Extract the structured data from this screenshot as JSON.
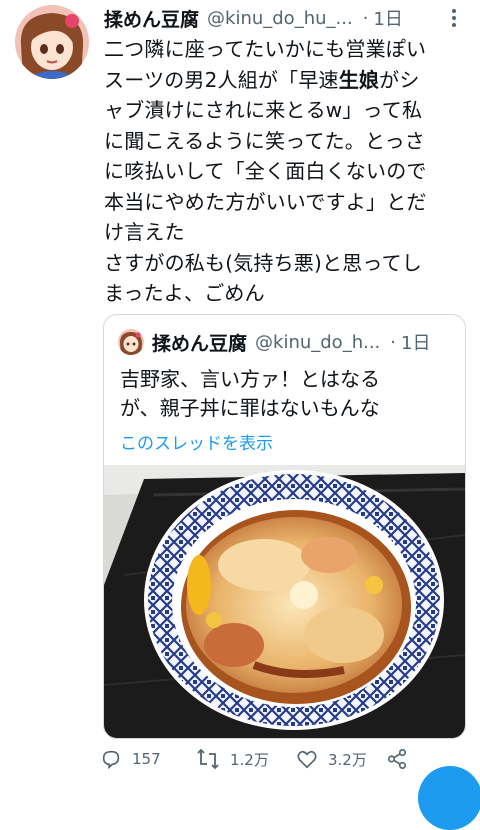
{
  "tweet": {
    "author_name": "揉めん豆腐",
    "handle": "@kinu_do_hu_...",
    "separator": "·",
    "time": "1日",
    "text_lines": [
      "二つ隣に座ってたいかにも営業ぽい",
      "スーツの男2人組が「早速",
      "生娘",
      "がシ",
      "ャブ漬けにされに来とるw」って私",
      "に聞こえるように笑ってた。とっさ",
      "に咳払いして「全く面白くないので",
      "本当にやめた方がいいですよ」とだ",
      "け言えた",
      "さすがの私も(気持ち悪)と思ってし",
      "まったよ、ごめん"
    ]
  },
  "quote": {
    "author_name": "揉めん豆腐",
    "handle": "@kinu_do_h...",
    "separator": "·",
    "time": "1日",
    "text_lines": [
      "吉野家、言い方ァ！とはなる",
      "が、親子丼に罪はないもんな"
    ],
    "thread_link": "このスレッドを表示"
  },
  "actions": {
    "replies": "157",
    "retweets": "1.2万",
    "likes": "3.2万"
  },
  "colors": {
    "accent": "#1d9bf0",
    "secondary_text": "#536471",
    "border": "#cfd9de"
  },
  "icons": [
    "more-icon",
    "reply-icon",
    "retweet-icon",
    "like-icon",
    "share-icon"
  ]
}
